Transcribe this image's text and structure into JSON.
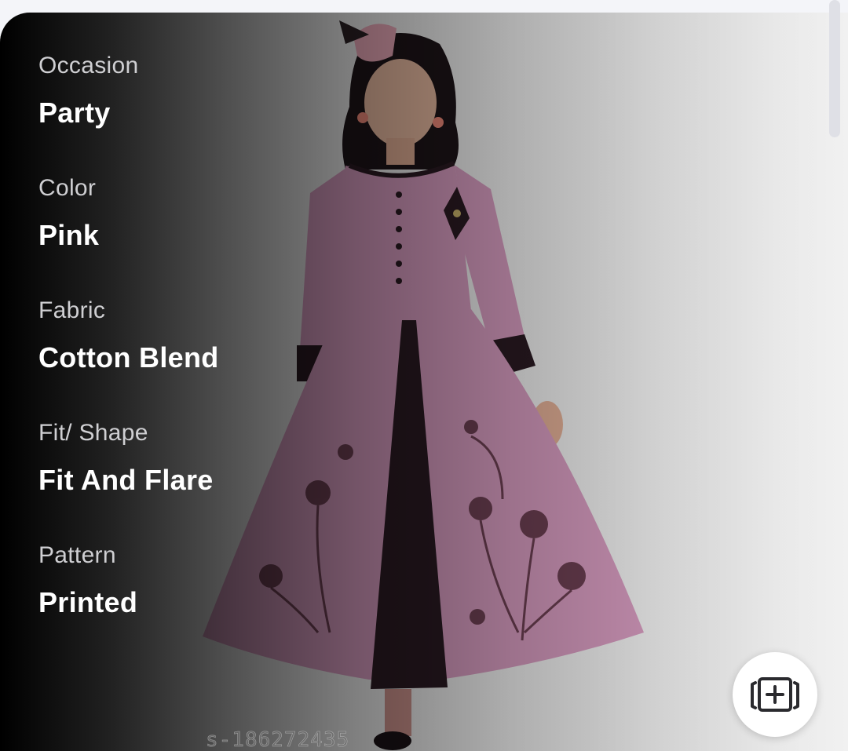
{
  "product": {
    "details": [
      {
        "label": "Occasion",
        "value": "Party"
      },
      {
        "label": "Color",
        "value": "Pink"
      },
      {
        "label": "Fabric",
        "value": "Cotton Blend"
      },
      {
        "label": "Fit/ Shape",
        "value": "Fit And Flare"
      },
      {
        "label": "Pattern",
        "value": "Printed"
      }
    ],
    "watermark": "s-186272435",
    "image_icon": "girl-in-pink-anarkali-dress-image"
  },
  "fab": {
    "icon": "add-to-collection-icon"
  },
  "colors": {
    "dress_pink": "#d69bbf",
    "dress_trim": "#2a1a22",
    "label_gray": "#cfcfd2",
    "value_white": "#ffffff",
    "background": "#f4f5f9"
  }
}
